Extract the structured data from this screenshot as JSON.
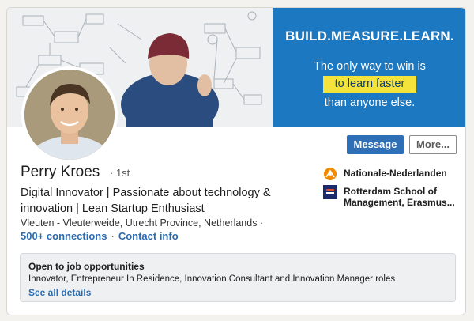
{
  "banner": {
    "ad_headline": "BUILD.MEASURE.LEARN.",
    "ad_line1": "The only way to win is",
    "ad_highlight": "to learn faster",
    "ad_line3": "than anyone else."
  },
  "actions": {
    "message_label": "Message",
    "more_label": "More..."
  },
  "profile": {
    "name": "Perry Kroes",
    "degree": "· 1st",
    "headline": "Digital Innovator | Passionate about technology & innovation | Lean Startup Enthusiast",
    "location": "Vleuten - Vleuterweide, Utrecht Province, Netherlands ·",
    "connections": "500+ connections",
    "separator": "·",
    "contact_info": "Contact info"
  },
  "companies": [
    {
      "name": "Nationale-Nederlanden",
      "icon": "nn-logo-icon"
    },
    {
      "name": "Rotterdam School of Management, Erasmus...",
      "icon": "rsm-logo-icon"
    }
  ],
  "job_opportunities": {
    "title": "Open to job opportunities",
    "description": "Innovator, Entrepreneur In Residence, Innovation Consultant and Innovation Manager roles",
    "link": "See all details"
  },
  "colors": {
    "primary_button": "#2e6fb6",
    "link": "#2b6cb0",
    "ad_background": "#1c78c0",
    "ad_highlight": "#f4e33a"
  }
}
